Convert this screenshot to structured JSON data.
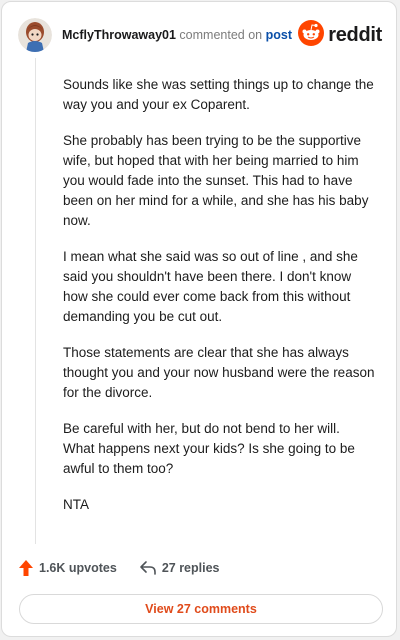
{
  "comment": {
    "username": "McflyThrowaway01",
    "action_text": "commented on",
    "post_link": "post",
    "avatar_icon": "snoo-avatar-icon",
    "paragraphs": [
      "Sounds like she was setting things up to change the way you and your ex Coparent.",
      "She probably has been trying to be the supportive wife, but hoped that with her being married to him you would fade into the sunset. This had to have been on her mind for a while, and she has his baby now.",
      "I mean what she said was so out of line , and she said you shouldn't have been there. I don't know how she could ever come back from this without demanding you be cut out.",
      "Those statements are clear that she has always thought you and your now husband were the reason for the divorce.",
      "Be careful with her, but do not bend to her will. What happens next your kids? Is she going to be awful to them too?",
      "NTA"
    ]
  },
  "brand": {
    "name": "reddit",
    "icon": "reddit-logo-icon",
    "color": "#ff4500"
  },
  "footer": {
    "upvotes_label": "1.6K upvotes",
    "replies_label": "27 replies",
    "upvote_icon": "upvote-arrow-icon",
    "reply_icon": "reply-arrow-icon",
    "upvote_color": "#ff4500"
  },
  "view_comments_label": "View 27 comments",
  "colors": {
    "accent_link": "#0a4fa8",
    "view_button_text": "#e04b1b"
  }
}
